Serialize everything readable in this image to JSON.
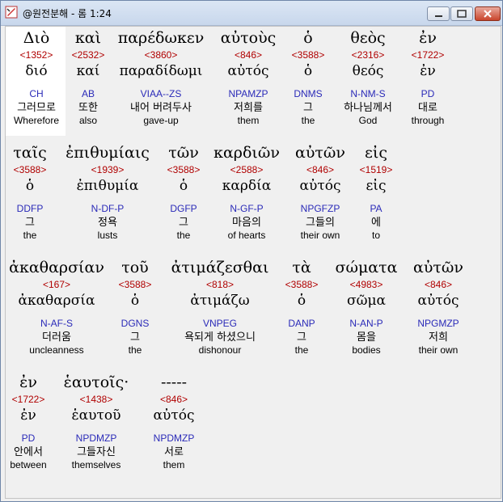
{
  "window": {
    "title": "@원전분해 - 롬 1:24"
  },
  "rows": [
    [
      {
        "greek": "Διὸ",
        "strong": "<1352>",
        "lemma": "διό",
        "parse": "CH",
        "korean": "그러므로",
        "english": "Wherefore"
      },
      {
        "greek": "καὶ",
        "strong": "<2532>",
        "lemma": "καί",
        "parse": "AB",
        "korean": "또한",
        "english": "also"
      },
      {
        "greek": "παρέδωκεν",
        "strong": "<3860>",
        "lemma": "παραδίδωμι",
        "parse": "VIAA--ZS",
        "korean": "내어 버려두사",
        "english": "gave-up"
      },
      {
        "greek": "αὐτοὺς",
        "strong": "<846>",
        "lemma": "αὐτός",
        "parse": "NPAMZP",
        "korean": "저희를",
        "english": "them"
      },
      {
        "greek": "ὁ",
        "strong": "<3588>",
        "lemma": "ὁ",
        "parse": "DNMS",
        "korean": "그",
        "english": "the"
      },
      {
        "greek": "θεὸς",
        "strong": "<2316>",
        "lemma": "θεός",
        "parse": "N-NM-S",
        "korean": "하나님께서",
        "english": "God"
      },
      {
        "greek": "ἐν",
        "strong": "<1722>",
        "lemma": "ἐν",
        "parse": "PD",
        "korean": "대로",
        "english": "through"
      }
    ],
    [
      {
        "greek": "ταῖς",
        "strong": "<3588>",
        "lemma": "ὁ",
        "parse": "DDFP",
        "korean": "그",
        "english": "the"
      },
      {
        "greek": "ἐπιθυμίαις",
        "strong": "<1939>",
        "lemma": "ἐπιθυμία",
        "parse": "N-DF-P",
        "korean": "정욕",
        "english": "lusts"
      },
      {
        "greek": "τῶν",
        "strong": "<3588>",
        "lemma": "ὁ",
        "parse": "DGFP",
        "korean": "그",
        "english": "the"
      },
      {
        "greek": "καρδιῶν",
        "strong": "<2588>",
        "lemma": "καρδία",
        "parse": "N-GF-P",
        "korean": "마음의",
        "english": "of hearts"
      },
      {
        "greek": "αὐτῶν",
        "strong": "<846>",
        "lemma": "αὐτός",
        "parse": "NPGFZP",
        "korean": "그들의",
        "english": "their own"
      },
      {
        "greek": "εἰς",
        "strong": "<1519>",
        "lemma": "εἰς",
        "parse": "PA",
        "korean": "에",
        "english": "to"
      }
    ],
    [
      {
        "greek": "ἀκαθαρσίαν",
        "strong": "<167>",
        "lemma": "ἀκαθαρσία",
        "parse": "N-AF-S",
        "korean": "더러움",
        "english": "uncleanness"
      },
      {
        "greek": "τοῦ",
        "strong": "<3588>",
        "lemma": "ὁ",
        "parse": "DGNS",
        "korean": "그",
        "english": "the"
      },
      {
        "greek": "ἀτιμάζεσθαι",
        "strong": "<818>",
        "lemma": "ἀτιμάζω",
        "parse": "VNPEG",
        "korean": "욕되게 하셨으니",
        "english": "dishonour"
      },
      {
        "greek": "τὰ",
        "strong": "<3588>",
        "lemma": "ὁ",
        "parse": "DANP",
        "korean": "그",
        "english": "the"
      },
      {
        "greek": "σώματα",
        "strong": "<4983>",
        "lemma": "σῶμα",
        "parse": "N-AN-P",
        "korean": "몸을",
        "english": "bodies"
      },
      {
        "greek": "αὐτῶν",
        "strong": "<846>",
        "lemma": "αὐτός",
        "parse": "NPGMZP",
        "korean": "저희",
        "english": "their own"
      }
    ],
    [
      {
        "greek": "ἐν",
        "strong": "<1722>",
        "lemma": "ἐν",
        "parse": "PD",
        "korean": "안에서",
        "english": "between"
      },
      {
        "greek": "ἑαυτοῖς·",
        "strong": "<1438>",
        "lemma": "ἑαυτοῦ",
        "parse": "NPDMZP",
        "korean": "그들자신",
        "english": "themselves"
      },
      {
        "greek": "-----",
        "strong": "<846>",
        "lemma": "αὐτός",
        "parse": "NPDMZP",
        "korean": "서로",
        "english": "them"
      }
    ]
  ]
}
